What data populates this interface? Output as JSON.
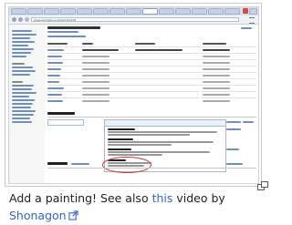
{
  "browser": {
    "url": "www.wikidata.org/wiki/Q12418"
  },
  "caption": {
    "text_before": "Add a painting! See also ",
    "link1": "this",
    "text_middle": " video by ",
    "link2": "Shonagon"
  },
  "colors": {
    "link": "#3366cc",
    "annotation_oval": "#d83030",
    "tab_close": "#d84a3a"
  },
  "icons": {
    "external_link": "external-link-icon",
    "enlarge": "enlarge-icon"
  }
}
